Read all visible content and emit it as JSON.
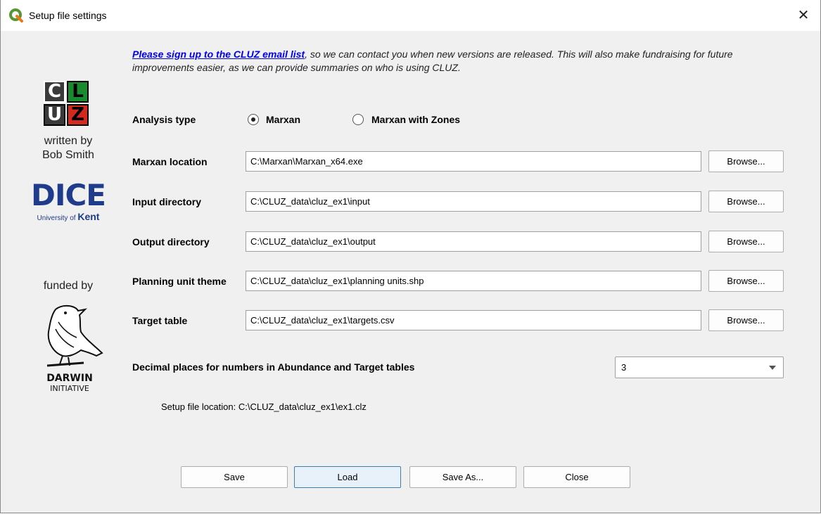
{
  "window": {
    "title": "Setup file settings",
    "close_glyph": "✕"
  },
  "branding": {
    "logo_letters": [
      "C",
      "L",
      "U",
      "Z"
    ],
    "written_by": "written by",
    "author": "Bob Smith",
    "dice": "DICE",
    "university_prefix": "University of",
    "university_name": "Kent",
    "funded_by": "funded by",
    "darwin_1": "DARWIN",
    "darwin_2": "INITIATIVE"
  },
  "intro": {
    "link_text": "Please sign up to the CLUZ email list",
    "rest_text": ", so we can contact you when new versions are released. This will also make fundraising for future improvements easier, as we can provide summaries on who is using CLUZ."
  },
  "analysis": {
    "label": "Analysis type",
    "option_1": "Marxan",
    "option_2": "Marxan with Zones",
    "selected": "Marxan"
  },
  "fields": [
    {
      "label": "Marxan location",
      "value": "C:\\Marxan\\Marxan_x64.exe",
      "button": "Browse..."
    },
    {
      "label": "Input directory",
      "value": "C:\\CLUZ_data\\cluz_ex1\\input",
      "button": "Browse..."
    },
    {
      "label": "Output directory",
      "value": "C:\\CLUZ_data\\cluz_ex1\\output",
      "button": "Browse..."
    },
    {
      "label": "Planning unit theme",
      "value": "C:\\CLUZ_data\\cluz_ex1\\planning units.shp",
      "button": "Browse..."
    },
    {
      "label": "Target table",
      "value": "C:\\CLUZ_data\\cluz_ex1\\targets.csv",
      "button": "Browse..."
    }
  ],
  "decimal": {
    "label": "Decimal places for numbers in Abundance and Target tables",
    "value": "3"
  },
  "setup_location": "Setup file location: C:\\CLUZ_data\\cluz_ex1\\ex1.clz",
  "buttons": {
    "save": "Save",
    "load": "Load",
    "save_as": "Save As...",
    "close": "Close"
  },
  "colors": {
    "logo_dark": "#3a3a3a",
    "logo_green": "#1a8a2e",
    "logo_red": "#d42a1e",
    "dice_blue": "#1f3b8c",
    "link": "#0000ee"
  }
}
